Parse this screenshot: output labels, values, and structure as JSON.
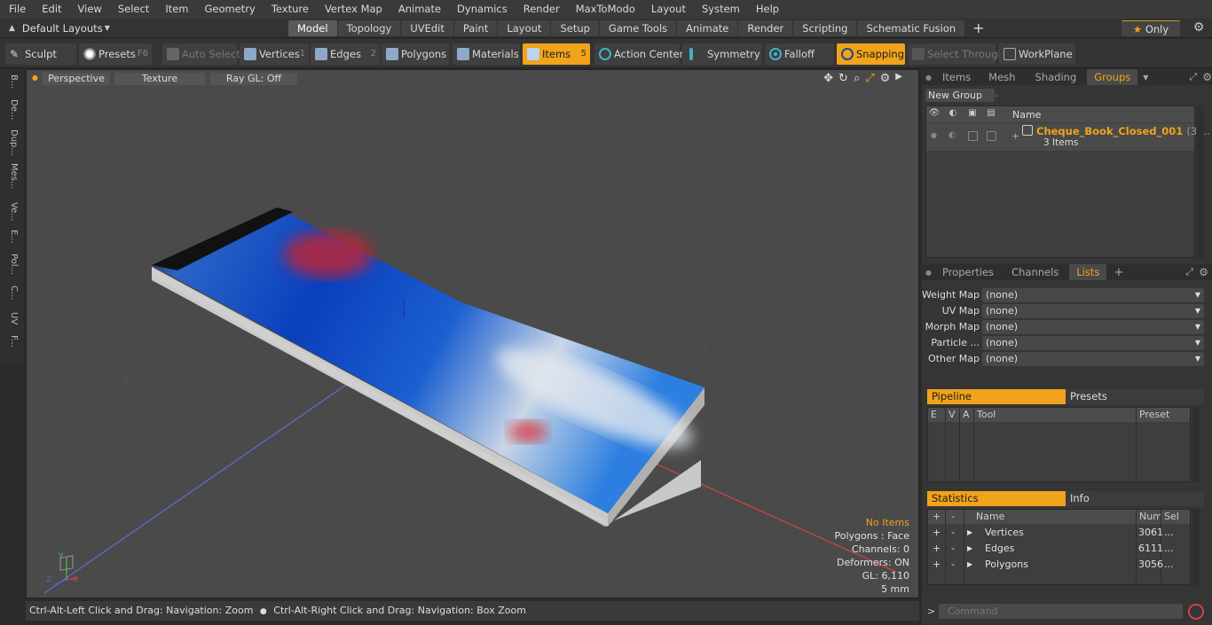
{
  "menu": [
    "File",
    "Edit",
    "View",
    "Select",
    "Item",
    "Geometry",
    "Texture",
    "Vertex Map",
    "Animate",
    "Dynamics",
    "Render",
    "MaxToModo",
    "Layout",
    "System",
    "Help"
  ],
  "layout_selector": "Default Layouts",
  "layout_tabs": [
    "Model",
    "Topology",
    "UVEdit",
    "Paint",
    "Layout",
    "Setup",
    "Game Tools",
    "Animate",
    "Render",
    "Scripting",
    "Schematic Fusion"
  ],
  "only_label": "Only",
  "toolbar": {
    "sculpt": "Sculpt",
    "presets": "Presets",
    "presets_key": "F6",
    "auto_select": "Auto Select",
    "vertices": "Vertices",
    "vertices_num": "1",
    "edges": "Edges",
    "edges_num": "2",
    "polygons": "Polygons",
    "materials": "Materials",
    "items": "Items",
    "items_num": "5",
    "action_center": "Action Center",
    "symmetry": "Symmetry",
    "falloff": "Falloff",
    "snapping": "Snapping",
    "select_through": "Select Through",
    "workplane": "WorkPlane"
  },
  "left_tabs": [
    "B...",
    "De...",
    "Dup...",
    "Mes...",
    "Ve...",
    "E...",
    "Pol...",
    "C...",
    "UV",
    "F..."
  ],
  "viewport": {
    "view_mode": "Perspective",
    "shading": "Texture",
    "raygl": "Ray GL: Off",
    "axis_neg_x": "-X",
    "axis_neg_z": "-Z",
    "info": {
      "items": "No Items",
      "polygons": "Polygons : Face",
      "channels": "Channels: 0",
      "deformers": "Deformers: ON",
      "gl": "GL: 6,110",
      "unit": "5 mm"
    }
  },
  "status_bar": {
    "hint1": "Ctrl-Alt-Left Click and Drag: Navigation: Zoom",
    "hint2": "Ctrl-Alt-Right Click and Drag: Navigation: Box Zoom"
  },
  "groups_panel": {
    "tabs": [
      "Items",
      "Mesh ...",
      "Shading",
      "Groups"
    ],
    "active_tab": "Groups",
    "new_group": "New Group",
    "col_name": "Name",
    "group_name": "Cheque_Book_Closed_001",
    "group_suffix": "(3 ...",
    "group_sub": "3 Items"
  },
  "props_panel": {
    "tabs": [
      "Properties",
      "Channels",
      "Lists"
    ],
    "active_tab": "Lists",
    "fields": [
      {
        "label": "Weight Map",
        "value": "(none)"
      },
      {
        "label": "UV Map",
        "value": "(none)"
      },
      {
        "label": "Morph Map",
        "value": "(none)"
      },
      {
        "label": "Particle ...",
        "value": "(none)"
      },
      {
        "label": "Other Map",
        "value": "(none)"
      }
    ]
  },
  "pipeline": {
    "tab_active": "Pipeline",
    "tab_inactive": "Presets",
    "cols": [
      "E",
      "V",
      "A",
      "Tool",
      "Preset"
    ]
  },
  "statistics": {
    "tab_active": "Statistics",
    "tab_inactive": "Info",
    "cols": [
      "+",
      "-",
      "Name",
      "Num",
      "Sel"
    ],
    "rows": [
      {
        "plus": "+",
        "minus": "-",
        "name": "Vertices",
        "num": "3061",
        "sel": "..."
      },
      {
        "plus": "+",
        "minus": "-",
        "name": "Edges",
        "num": "6111",
        "sel": "..."
      },
      {
        "plus": "+",
        "minus": "-",
        "name": "Polygons",
        "num": "3056",
        "sel": "..."
      }
    ]
  },
  "command_placeholder": "Command",
  "colors": {
    "accent": "#f0a31b",
    "viewport_bg": "#4a4a4a",
    "panel_bg": "#353535"
  }
}
